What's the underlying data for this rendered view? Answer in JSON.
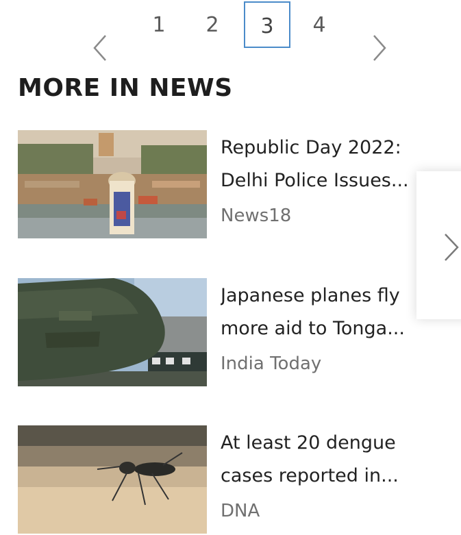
{
  "pagination": {
    "pages": [
      "1",
      "2",
      "3",
      "4"
    ],
    "active": "3"
  },
  "section": {
    "title": "MORE IN NEWS"
  },
  "articles": [
    {
      "line1": "Republic Day 2022:",
      "line2": "Delhi Police Issues...",
      "source": "News18"
    },
    {
      "line1": "Japanese planes fly",
      "line2": "more aid to Tonga...",
      "source": "India Today"
    },
    {
      "line1": "At least 20 dengue",
      "line2": "cases reported in...",
      "source": "DNA"
    }
  ],
  "colors": {
    "active_page_border": "#4a8bc9"
  },
  "icons": {
    "prev": "chevron-left-icon",
    "next": "chevron-right-icon",
    "carousel_next": "chevron-right-icon"
  }
}
